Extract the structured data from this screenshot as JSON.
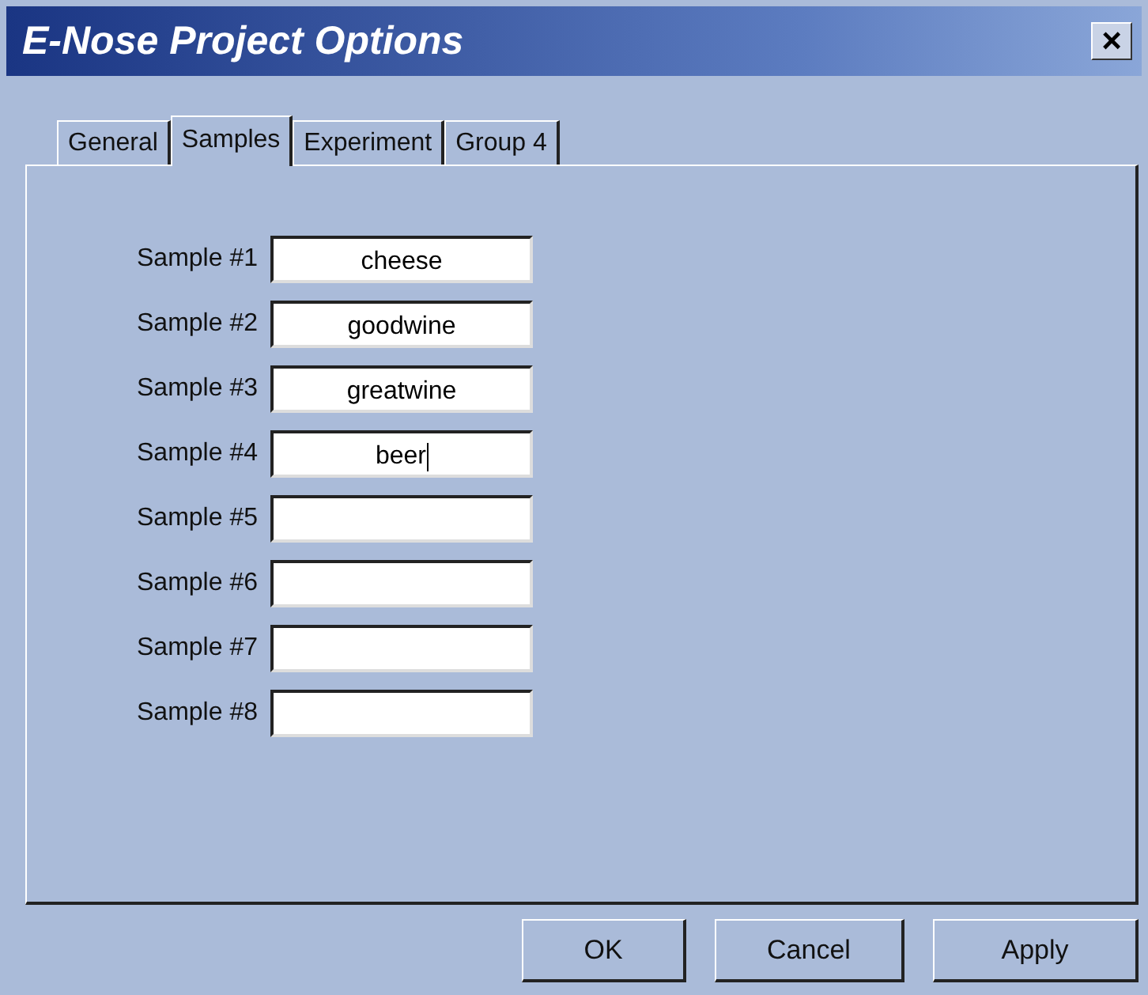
{
  "window": {
    "title": "E-Nose Project Options",
    "close": "×"
  },
  "tabs": [
    {
      "label": "General",
      "selected": false
    },
    {
      "label": "Samples",
      "selected": true
    },
    {
      "label": "Experiment",
      "selected": false
    },
    {
      "label": "Group 4",
      "selected": false
    }
  ],
  "samples": [
    {
      "label": "Sample #1",
      "value": "cheese",
      "focused": false
    },
    {
      "label": "Sample #2",
      "value": "goodwine",
      "focused": false
    },
    {
      "label": "Sample #3",
      "value": "greatwine",
      "focused": false
    },
    {
      "label": "Sample #4",
      "value": "beer",
      "focused": true
    },
    {
      "label": "Sample #5",
      "focused": false
    },
    {
      "label": "Sample #6",
      "focused": false
    },
    {
      "label": "Sample #7",
      "focused": false
    },
    {
      "label": "Sample #8",
      "focused": false
    }
  ],
  "buttons": [
    "OK",
    "Cancel",
    "Apply"
  ]
}
